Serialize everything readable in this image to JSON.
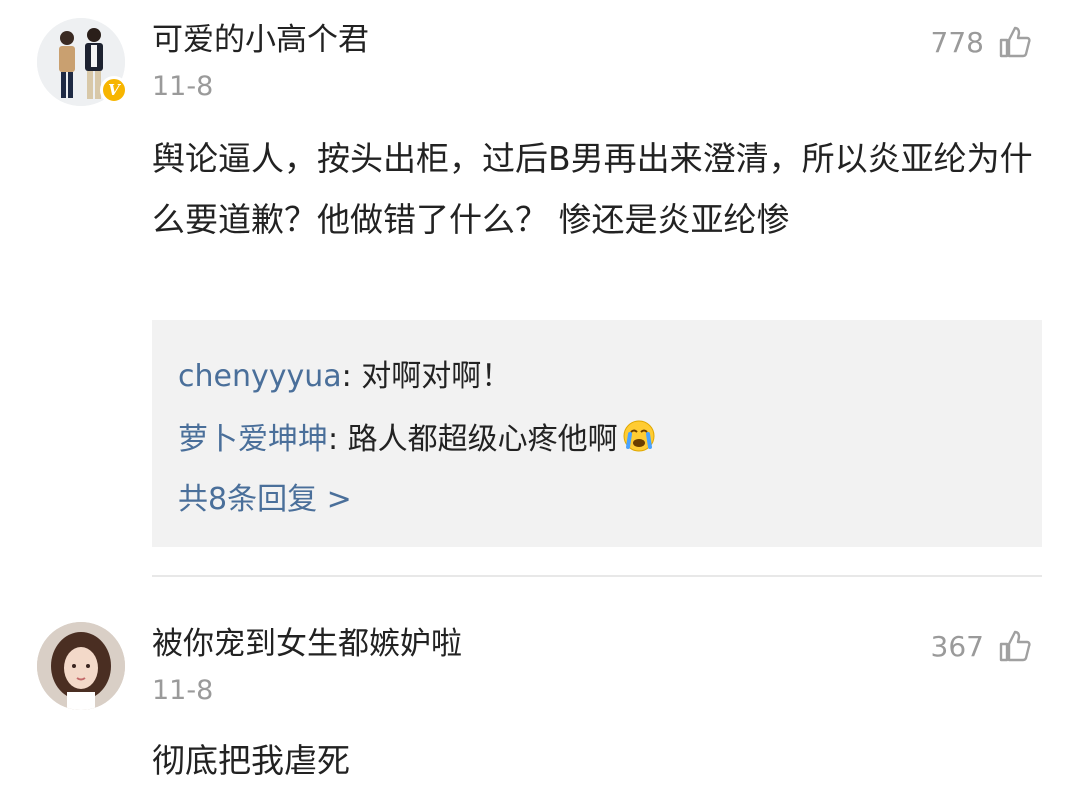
{
  "comments": [
    {
      "username": "可爱的小高个君",
      "verified_badge": "V",
      "date": "11-8",
      "likes": "778",
      "like_icon": "thumbs-up-icon",
      "text": "舆论逼人，按头出柜，过后B男再出来澄清，所以炎亚纶为什么要道歉？他做错了什么？ 惨还是炎亚纶惨",
      "replies": [
        {
          "author": "chenyyyua",
          "separator": ": ",
          "text": "对啊对啊！"
        },
        {
          "author": "萝卜爱坤坤",
          "separator": ": ",
          "text": "路人都超级心疼他啊",
          "emoji": "crying-face-emoji"
        }
      ],
      "more_replies": "共8条回复 >"
    },
    {
      "username": "被你宠到女生都嫉妒啦",
      "date": "11-8",
      "likes": "367",
      "like_icon": "thumbs-up-icon",
      "text": "彻底把我虐死"
    }
  ],
  "colors": {
    "username": "#222222",
    "meta_gray": "#9a9a9a",
    "reply_link": "#4a6f9a",
    "reply_bg": "#f2f2f2",
    "verified": "#f7b500",
    "divider": "#e8e8e8"
  }
}
